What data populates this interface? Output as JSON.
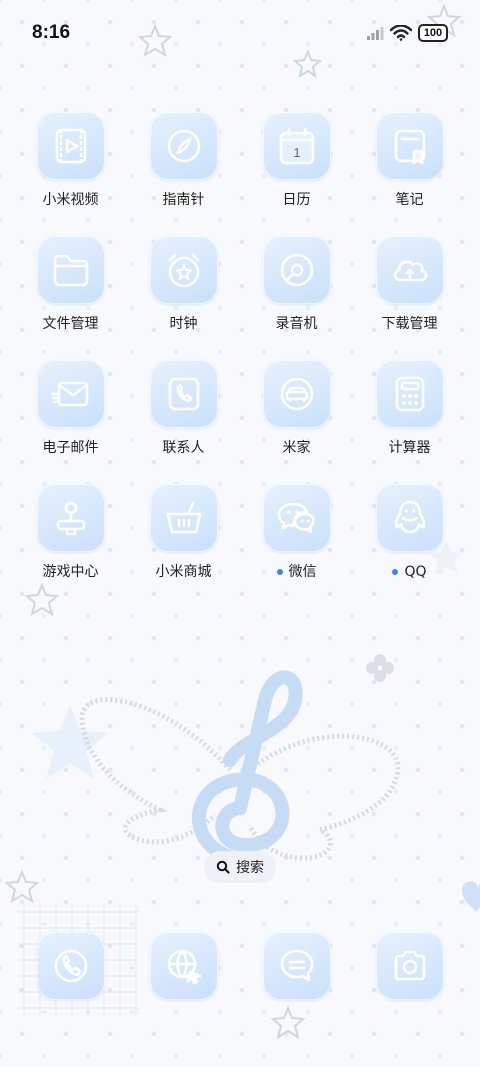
{
  "status_bar": {
    "time": "8:16",
    "battery": "100",
    "icons": [
      "signal-icon",
      "wifi-icon",
      "battery-icon"
    ]
  },
  "apps": [
    {
      "label": "小米视频",
      "icon": "video-icon",
      "dot": false
    },
    {
      "label": "指南针",
      "icon": "compass-icon",
      "dot": false
    },
    {
      "label": "日历",
      "icon": "calendar-icon",
      "dot": false,
      "day": "1"
    },
    {
      "label": "笔记",
      "icon": "notes-icon",
      "dot": false
    },
    {
      "label": "文件管理",
      "icon": "folder-icon",
      "dot": false
    },
    {
      "label": "时钟",
      "icon": "alarm-clock-icon",
      "dot": false
    },
    {
      "label": "录音机",
      "icon": "recorder-icon",
      "dot": false
    },
    {
      "label": "下载管理",
      "icon": "cloud-upload-icon",
      "dot": false
    },
    {
      "label": "电子邮件",
      "icon": "mail-icon",
      "dot": false
    },
    {
      "label": "联系人",
      "icon": "contacts-phone-icon",
      "dot": false
    },
    {
      "label": "米家",
      "icon": "sofa-icon",
      "dot": false
    },
    {
      "label": "计算器",
      "icon": "calculator-icon",
      "dot": false
    },
    {
      "label": "游戏中心",
      "icon": "joystick-icon",
      "dot": false
    },
    {
      "label": "小米商城",
      "icon": "basket-icon",
      "dot": false
    },
    {
      "label": "微信",
      "icon": "wechat-icon",
      "dot": true
    },
    {
      "label": "QQ",
      "icon": "qq-penguin-icon",
      "dot": true
    }
  ],
  "search": {
    "label": "搜索"
  },
  "dock": [
    {
      "icon": "phone-icon"
    },
    {
      "icon": "browser-globe-icon"
    },
    {
      "icon": "messages-icon"
    },
    {
      "icon": "camera-icon"
    }
  ],
  "colors": {
    "tile_top": "#e6f1fd",
    "tile_bottom": "#c9e0fa",
    "icon_stroke": "#ffffff",
    "dot": "#3b82f6"
  }
}
